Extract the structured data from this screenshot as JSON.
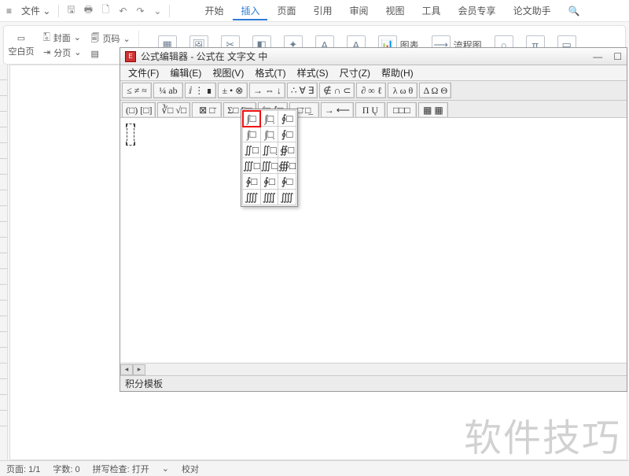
{
  "titlebar": {
    "file_label": "文件",
    "dropdown_glyph": "⌄"
  },
  "tabs": {
    "items": [
      "开始",
      "插入",
      "页面",
      "引用",
      "审阅",
      "视图",
      "工具",
      "会员专享",
      "论文助手"
    ],
    "active_index": 1
  },
  "ribbon": {
    "blank_page": "空白页",
    "cover": "封面",
    "page_num": "页码",
    "split_page": "分页",
    "chart_label": "图表",
    "flowchart_label": "流程图"
  },
  "eq": {
    "title": "公式编辑器 - 公式在 文字文 中",
    "title_icon_text": "E",
    "menu": [
      "文件(F)",
      "编辑(E)",
      "视图(V)",
      "格式(T)",
      "样式(S)",
      "尺寸(Z)",
      "帮助(H)"
    ],
    "row1": [
      "≤ ≠ ≈",
      "¼ ab",
      "ⅈ ⋮ ∎",
      "± • ⊗",
      "→ ⇔ ↓",
      "∴ ∀ ∃",
      "∉ ∩ ⊂",
      "∂ ∞ ℓ",
      "λ ω θ",
      "Δ Ω Θ"
    ],
    "row2": [
      "(□) [□]",
      "∛□ √□",
      "⊠ □̄",
      "Σ□ Σ□̣",
      "∫□ ∮□",
      "□̄ □̲",
      "→ ⟵",
      "Π Ų",
      "□□□",
      "▦ ▦"
    ],
    "status": "积分模板"
  },
  "palette": {
    "rows": [
      [
        "∫□",
        "∫□̣",
        "∮□"
      ],
      [
        "∫□",
        "∫□̣",
        "∮□"
      ],
      [
        "∬□",
        "∬□̣",
        "∯□"
      ],
      [
        "∭□",
        "∭□̣",
        "∰□"
      ],
      [
        "∳□",
        "∲□",
        "∳□"
      ],
      [
        "⨌",
        "⨌̣",
        "⨌"
      ]
    ],
    "highlight_row": 0,
    "highlight_col": 0
  },
  "footer": {
    "page": "页面: 1/1",
    "words": "字数: 0",
    "spell": "拼写检查: 打开",
    "proof": "校对"
  },
  "watermark": "软件技巧"
}
